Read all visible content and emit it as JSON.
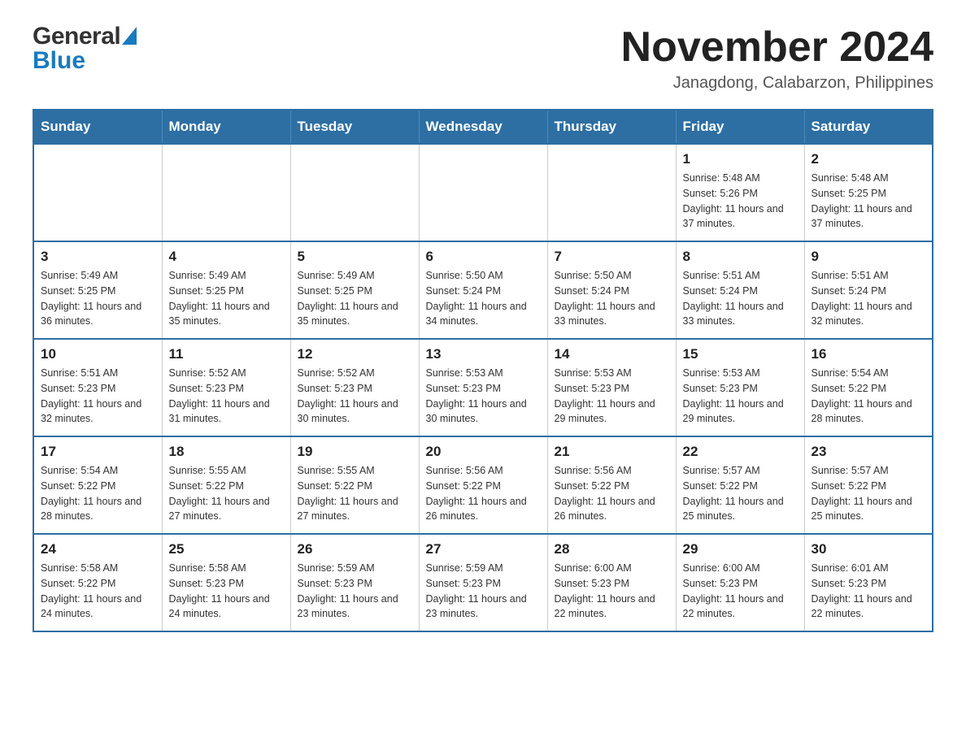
{
  "header": {
    "logo_general": "General",
    "logo_blue": "Blue",
    "title": "November 2024",
    "subtitle": "Janagdong, Calabarzon, Philippines"
  },
  "days_of_week": [
    "Sunday",
    "Monday",
    "Tuesday",
    "Wednesday",
    "Thursday",
    "Friday",
    "Saturday"
  ],
  "weeks": [
    [
      {
        "day": "",
        "info": ""
      },
      {
        "day": "",
        "info": ""
      },
      {
        "day": "",
        "info": ""
      },
      {
        "day": "",
        "info": ""
      },
      {
        "day": "",
        "info": ""
      },
      {
        "day": "1",
        "info": "Sunrise: 5:48 AM\nSunset: 5:26 PM\nDaylight: 11 hours and 37 minutes."
      },
      {
        "day": "2",
        "info": "Sunrise: 5:48 AM\nSunset: 5:25 PM\nDaylight: 11 hours and 37 minutes."
      }
    ],
    [
      {
        "day": "3",
        "info": "Sunrise: 5:49 AM\nSunset: 5:25 PM\nDaylight: 11 hours and 36 minutes."
      },
      {
        "day": "4",
        "info": "Sunrise: 5:49 AM\nSunset: 5:25 PM\nDaylight: 11 hours and 35 minutes."
      },
      {
        "day": "5",
        "info": "Sunrise: 5:49 AM\nSunset: 5:25 PM\nDaylight: 11 hours and 35 minutes."
      },
      {
        "day": "6",
        "info": "Sunrise: 5:50 AM\nSunset: 5:24 PM\nDaylight: 11 hours and 34 minutes."
      },
      {
        "day": "7",
        "info": "Sunrise: 5:50 AM\nSunset: 5:24 PM\nDaylight: 11 hours and 33 minutes."
      },
      {
        "day": "8",
        "info": "Sunrise: 5:51 AM\nSunset: 5:24 PM\nDaylight: 11 hours and 33 minutes."
      },
      {
        "day": "9",
        "info": "Sunrise: 5:51 AM\nSunset: 5:24 PM\nDaylight: 11 hours and 32 minutes."
      }
    ],
    [
      {
        "day": "10",
        "info": "Sunrise: 5:51 AM\nSunset: 5:23 PM\nDaylight: 11 hours and 32 minutes."
      },
      {
        "day": "11",
        "info": "Sunrise: 5:52 AM\nSunset: 5:23 PM\nDaylight: 11 hours and 31 minutes."
      },
      {
        "day": "12",
        "info": "Sunrise: 5:52 AM\nSunset: 5:23 PM\nDaylight: 11 hours and 30 minutes."
      },
      {
        "day": "13",
        "info": "Sunrise: 5:53 AM\nSunset: 5:23 PM\nDaylight: 11 hours and 30 minutes."
      },
      {
        "day": "14",
        "info": "Sunrise: 5:53 AM\nSunset: 5:23 PM\nDaylight: 11 hours and 29 minutes."
      },
      {
        "day": "15",
        "info": "Sunrise: 5:53 AM\nSunset: 5:23 PM\nDaylight: 11 hours and 29 minutes."
      },
      {
        "day": "16",
        "info": "Sunrise: 5:54 AM\nSunset: 5:22 PM\nDaylight: 11 hours and 28 minutes."
      }
    ],
    [
      {
        "day": "17",
        "info": "Sunrise: 5:54 AM\nSunset: 5:22 PM\nDaylight: 11 hours and 28 minutes."
      },
      {
        "day": "18",
        "info": "Sunrise: 5:55 AM\nSunset: 5:22 PM\nDaylight: 11 hours and 27 minutes."
      },
      {
        "day": "19",
        "info": "Sunrise: 5:55 AM\nSunset: 5:22 PM\nDaylight: 11 hours and 27 minutes."
      },
      {
        "day": "20",
        "info": "Sunrise: 5:56 AM\nSunset: 5:22 PM\nDaylight: 11 hours and 26 minutes."
      },
      {
        "day": "21",
        "info": "Sunrise: 5:56 AM\nSunset: 5:22 PM\nDaylight: 11 hours and 26 minutes."
      },
      {
        "day": "22",
        "info": "Sunrise: 5:57 AM\nSunset: 5:22 PM\nDaylight: 11 hours and 25 minutes."
      },
      {
        "day": "23",
        "info": "Sunrise: 5:57 AM\nSunset: 5:22 PM\nDaylight: 11 hours and 25 minutes."
      }
    ],
    [
      {
        "day": "24",
        "info": "Sunrise: 5:58 AM\nSunset: 5:22 PM\nDaylight: 11 hours and 24 minutes."
      },
      {
        "day": "25",
        "info": "Sunrise: 5:58 AM\nSunset: 5:23 PM\nDaylight: 11 hours and 24 minutes."
      },
      {
        "day": "26",
        "info": "Sunrise: 5:59 AM\nSunset: 5:23 PM\nDaylight: 11 hours and 23 minutes."
      },
      {
        "day": "27",
        "info": "Sunrise: 5:59 AM\nSunset: 5:23 PM\nDaylight: 11 hours and 23 minutes."
      },
      {
        "day": "28",
        "info": "Sunrise: 6:00 AM\nSunset: 5:23 PM\nDaylight: 11 hours and 22 minutes."
      },
      {
        "day": "29",
        "info": "Sunrise: 6:00 AM\nSunset: 5:23 PM\nDaylight: 11 hours and 22 minutes."
      },
      {
        "day": "30",
        "info": "Sunrise: 6:01 AM\nSunset: 5:23 PM\nDaylight: 11 hours and 22 minutes."
      }
    ]
  ]
}
